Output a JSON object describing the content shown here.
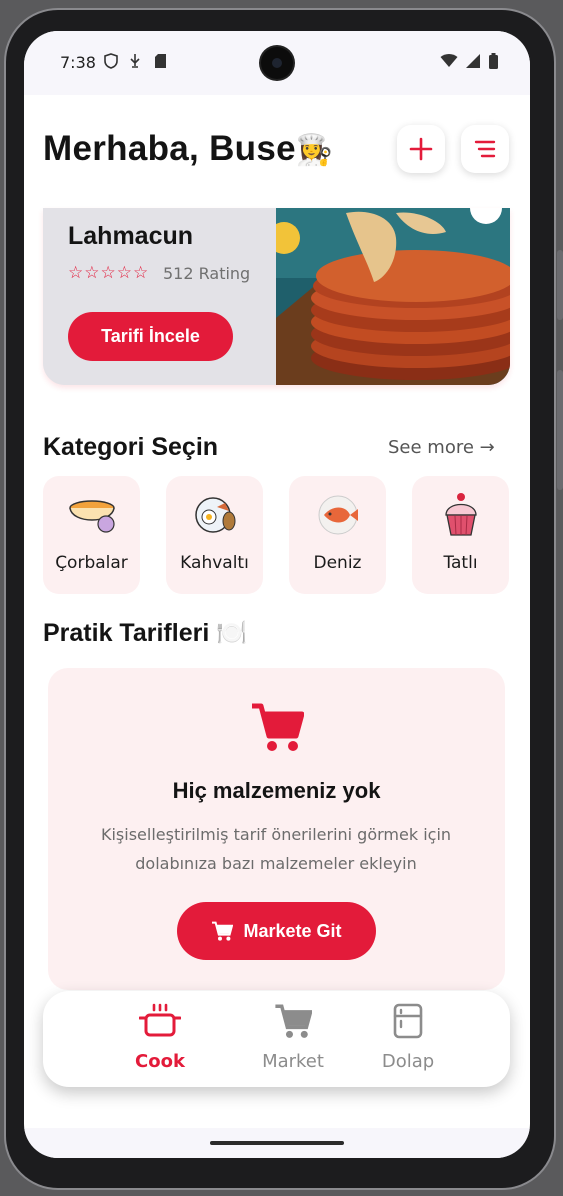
{
  "status": {
    "time": "7:38"
  },
  "header": {
    "greeting": "Merhaba, Buse",
    "chef_emoji": "👩‍🍳"
  },
  "hero": {
    "title": "Lahmacun",
    "stars": "☆☆☆☆☆",
    "rating_text": "512 Rating",
    "button_label": "Tarifi İncele"
  },
  "categories_section": {
    "title": "Kategori Seçin",
    "see_more": "See more →",
    "items": [
      {
        "label": "Çorbalar",
        "icon": "soup-bowl-icon"
      },
      {
        "label": "Kahvaltı",
        "icon": "breakfast-plate-icon"
      },
      {
        "label": "Deniz",
        "icon": "fish-plate-icon"
      },
      {
        "label": "Tatlı",
        "icon": "cupcake-icon"
      }
    ]
  },
  "quick_recipes": {
    "title": "Pratik Tarifleri 🍽️",
    "empty_title": "Hiç malzemeniz yok",
    "empty_desc": "Kişiselleştirilmiş tarif önerilerini görmek için dolabınıza bazı malzemeler ekleyin",
    "market_button": "Markete Git"
  },
  "bottom_nav": {
    "items": [
      {
        "label": "Cook",
        "active": true
      },
      {
        "label": "Market",
        "active": false
      },
      {
        "label": "Dolap",
        "active": false
      }
    ]
  },
  "colors": {
    "accent": "#e31b3a",
    "card_bg": "#fdf0f1",
    "text": "#141414"
  }
}
